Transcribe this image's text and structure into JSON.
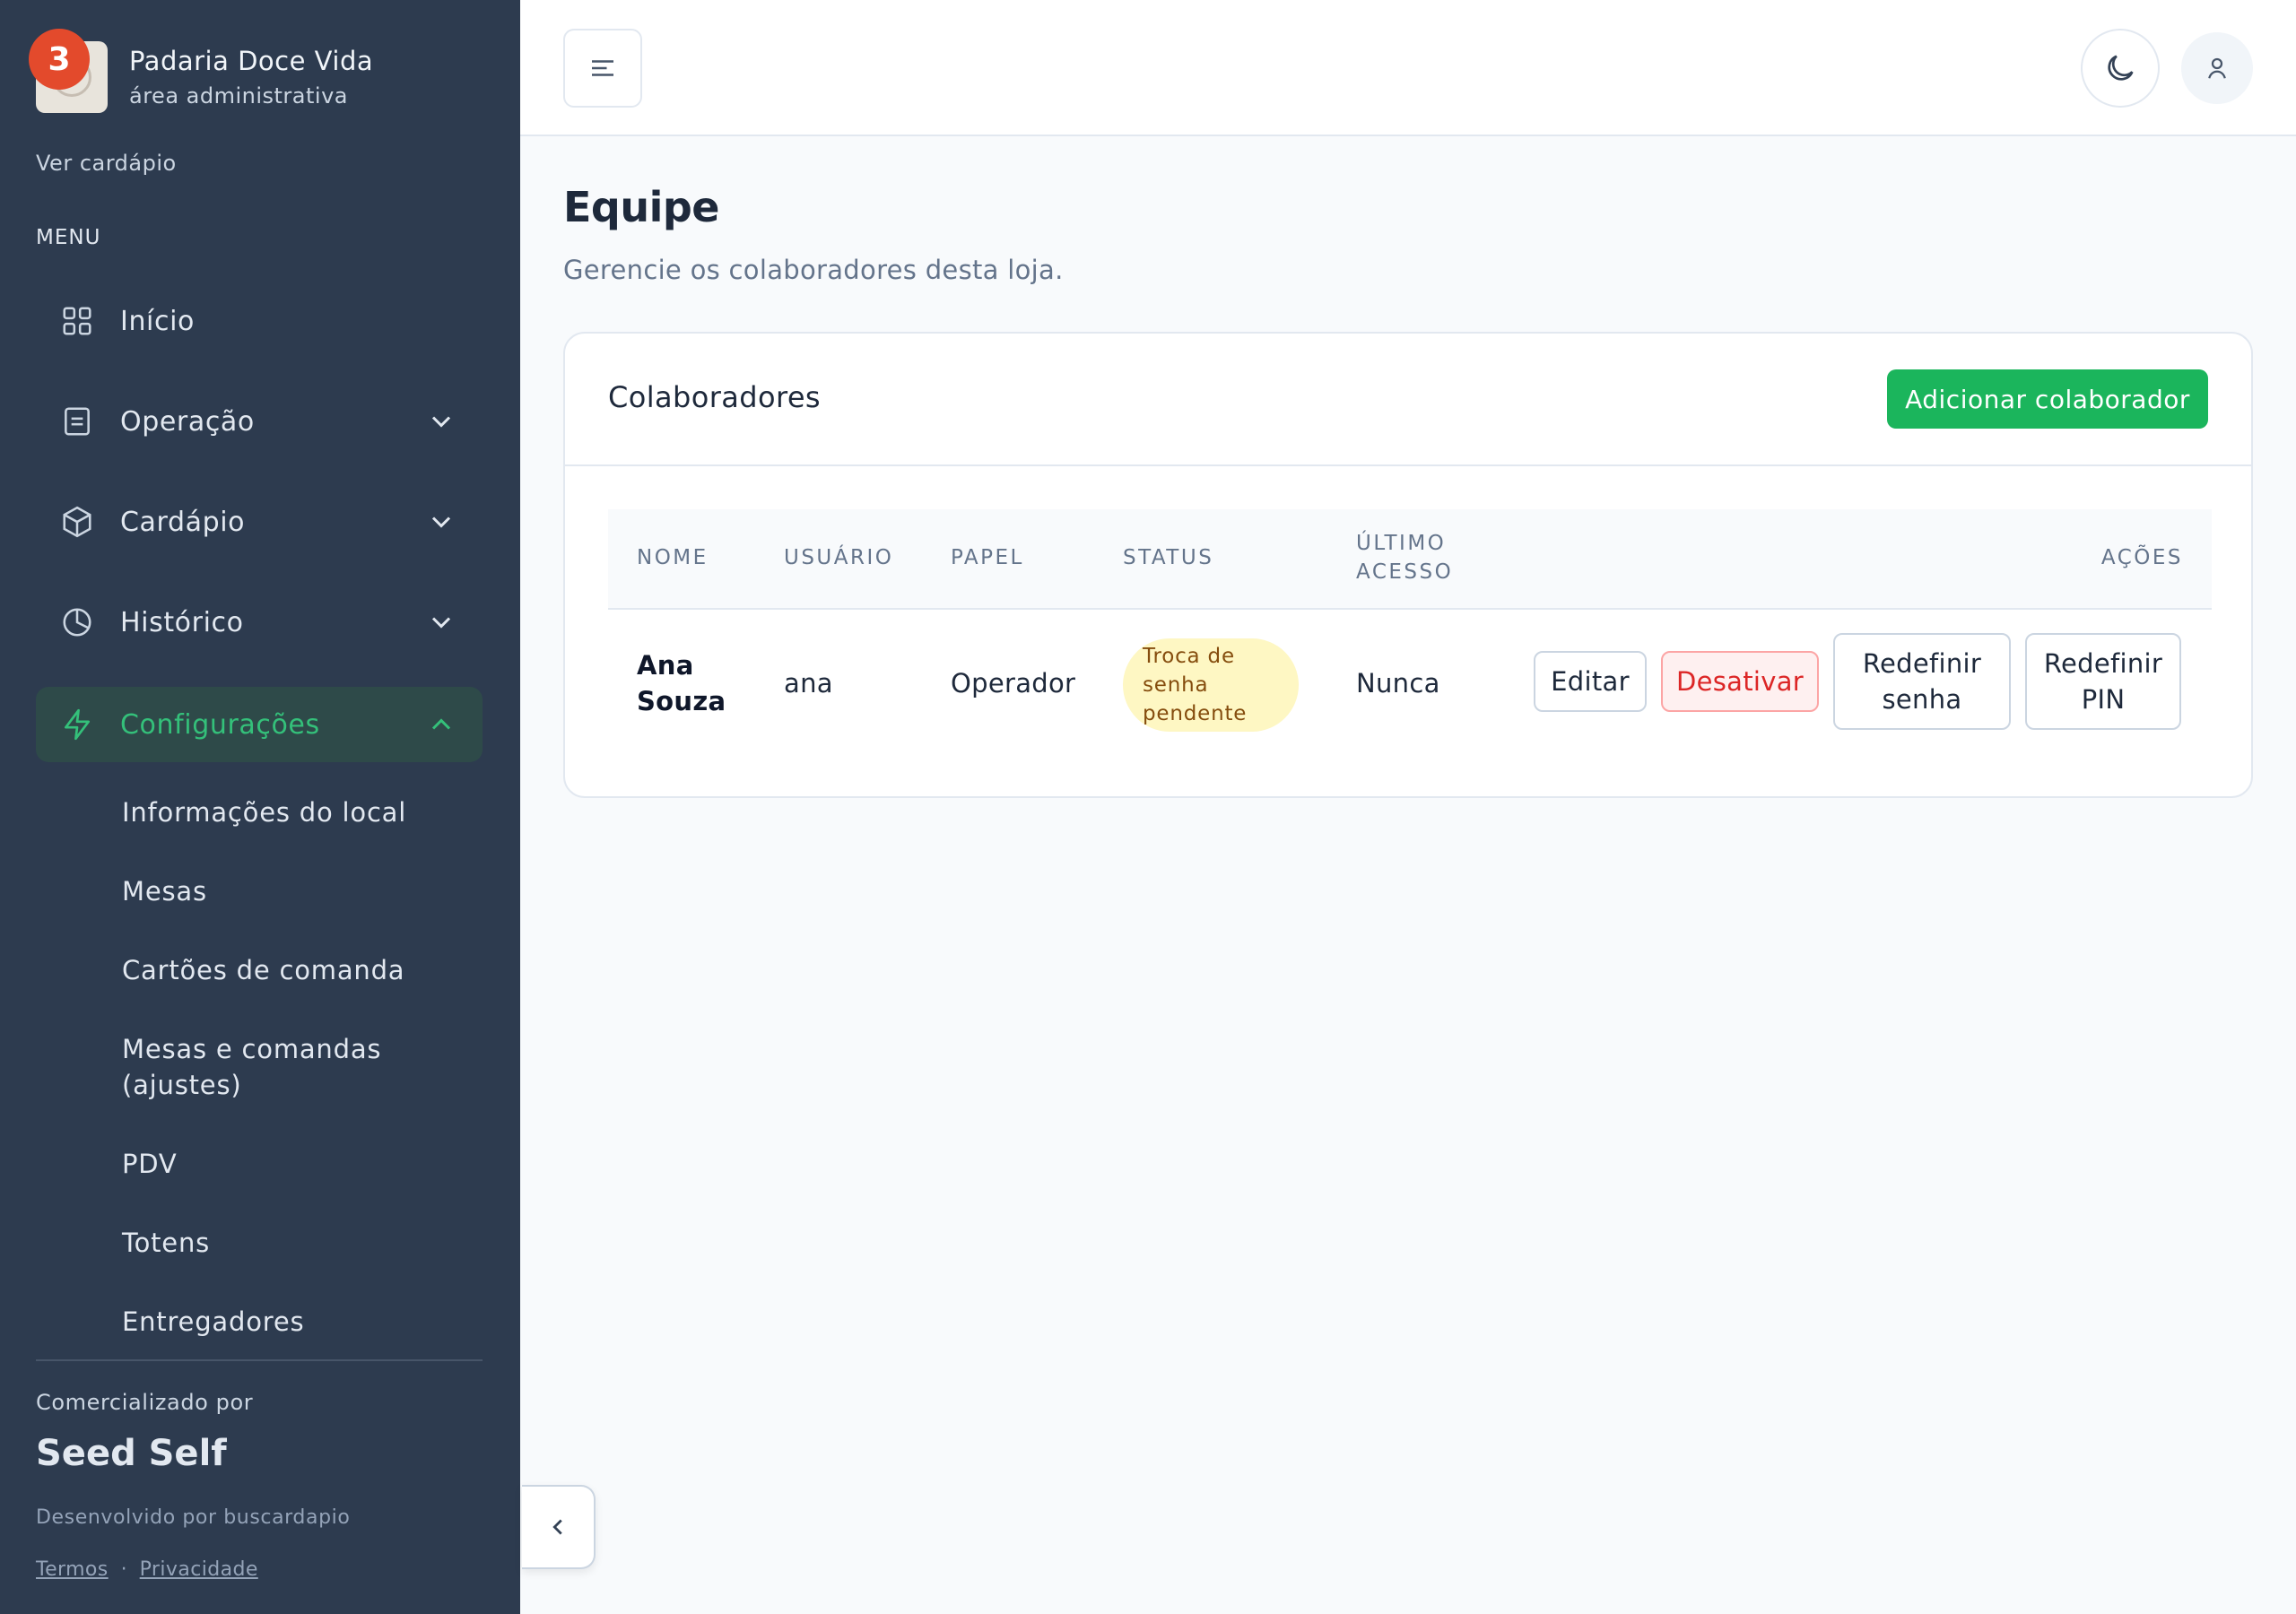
{
  "brand": {
    "name": "Padaria Doce Vida",
    "subtitle": "área administrativa",
    "notifications": "3"
  },
  "sidebar": {
    "view_menu_link": "Ver cardápio",
    "menu_heading": "MENU",
    "items": [
      {
        "label": "Início",
        "icon": "grid-icon"
      },
      {
        "label": "Operação",
        "icon": "document-icon"
      },
      {
        "label": "Cardápio",
        "icon": "box-icon"
      },
      {
        "label": "Histórico",
        "icon": "pie-chart-icon"
      },
      {
        "label": "Configurações",
        "icon": "lightning-icon"
      }
    ],
    "subitems": [
      "Informações do local",
      "Mesas",
      "Cartões de comanda",
      "Mesas e comandas (ajustes)",
      "PDV",
      "Totens",
      "Entregadores"
    ],
    "footer": {
      "sold_by": "Comercializado por",
      "company": "Seed Self",
      "developed_by": "Desenvolvido por buscardapio",
      "terms": "Termos",
      "separator": "·",
      "privacy": "Privacidade"
    }
  },
  "page": {
    "title": "Equipe",
    "subtitle": "Gerencie os colaboradores desta loja."
  },
  "card": {
    "title": "Colaboradores",
    "add_button": "Adicionar colaborador",
    "columns": [
      "NOME",
      "USUÁRIO",
      "PAPEL",
      "STATUS",
      "ÚLTIMO ACESSO",
      "AÇÕES"
    ],
    "rows": [
      {
        "name": "Ana Souza",
        "username": "ana",
        "role": "Operador",
        "status": "Troca de senha pendente",
        "last_access": "Nunca",
        "actions": {
          "edit": "Editar",
          "deactivate": "Desativar",
          "reset_password": "Redefinir senha",
          "reset_pin": "Redefinir PIN"
        }
      }
    ]
  },
  "colors": {
    "sidebar_bg": "#2d3b4f",
    "accent": "#1bb55c",
    "active_text": "#34c07a",
    "badge": "#e34a2c",
    "status_bg": "#fef7c3",
    "danger": "#dc2626"
  }
}
